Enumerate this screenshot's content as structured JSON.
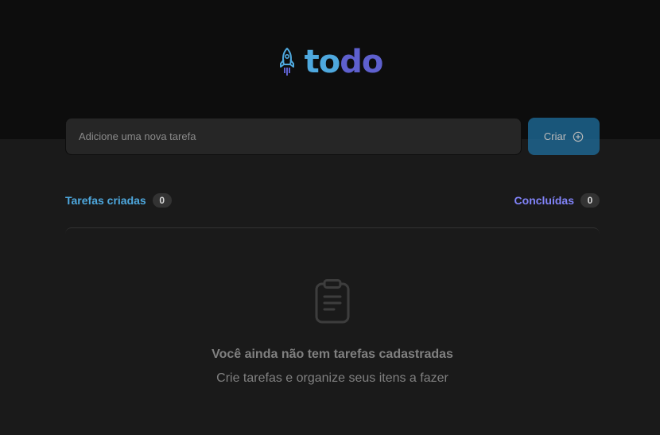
{
  "brand": {
    "logo_part1": "to",
    "logo_part2": "do",
    "logo_icon": "rocket-icon"
  },
  "form": {
    "placeholder": "Adicione uma nova tarefa",
    "value": "",
    "create_label": "Criar",
    "create_icon": "plus-circle-icon"
  },
  "counters": {
    "created_label": "Tarefas criadas",
    "created_count": "0",
    "done_label": "Concluídas",
    "done_count": "0"
  },
  "empty_state": {
    "icon": "clipboard-icon",
    "title": "Você ainda não tem tarefas cadastradas",
    "subtitle": "Crie tarefas e organize seus itens a fazer"
  },
  "colors": {
    "blue": "#4ea8de",
    "purple": "#5e60ce",
    "button": "#1e6f9f",
    "bg": "#1a1a1a",
    "header": "#0d0d0d"
  }
}
